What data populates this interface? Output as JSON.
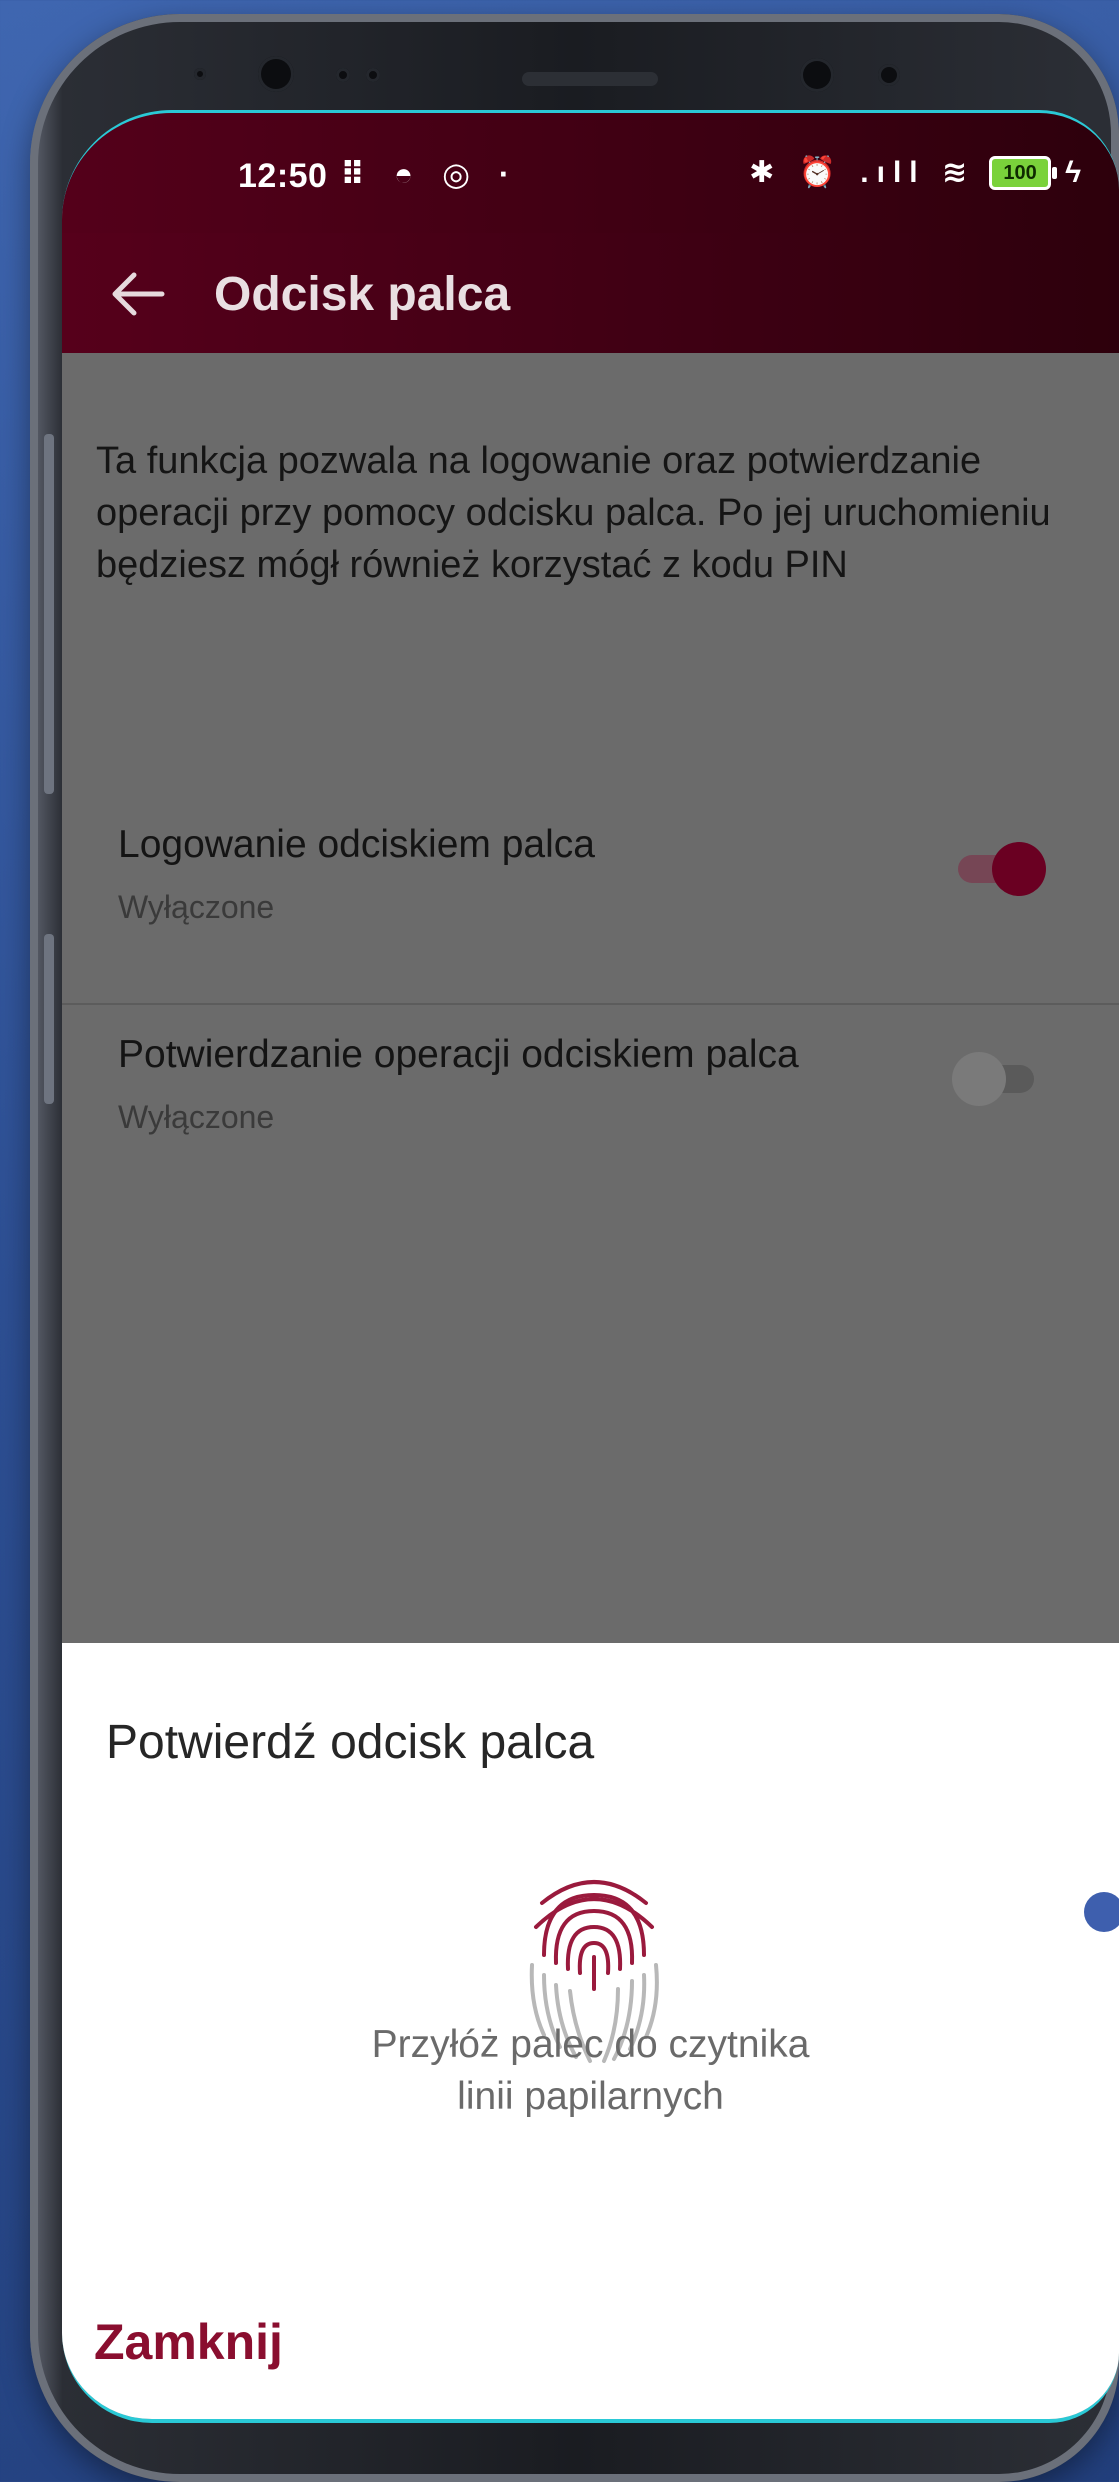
{
  "status_bar": {
    "time": "12:50",
    "left_icons": "⠿ ◓ ◎ ·",
    "right_icons": "✱ ⏰ .ıll ≋",
    "battery": "100"
  },
  "app_bar": {
    "title": "Odcisk palca"
  },
  "content": {
    "description": "Ta funkcja pozwala na logowanie oraz potwierdzanie operacji przy pomocy odcisku palca. Po jej uruchomieniu będziesz mógł również korzystać z kodu PIN",
    "settings": [
      {
        "title": "Logowanie odciskiem palca",
        "subtitle": "Wyłączone",
        "enabled": true
      },
      {
        "title": "Potwierdzanie operacji odciskiem palca",
        "subtitle": "Wyłączone",
        "enabled": false
      }
    ]
  },
  "dialog": {
    "title": "Potwierdź odcisk palca",
    "hint_line1": "Przyłóż palec do czytnika",
    "hint_line2": "linii papilarnych",
    "close_label": "Zamknij"
  },
  "colors": {
    "brand": "#8a0e2f",
    "app_bar": "#3e0013",
    "frame_accent": "#2ac9d6"
  }
}
